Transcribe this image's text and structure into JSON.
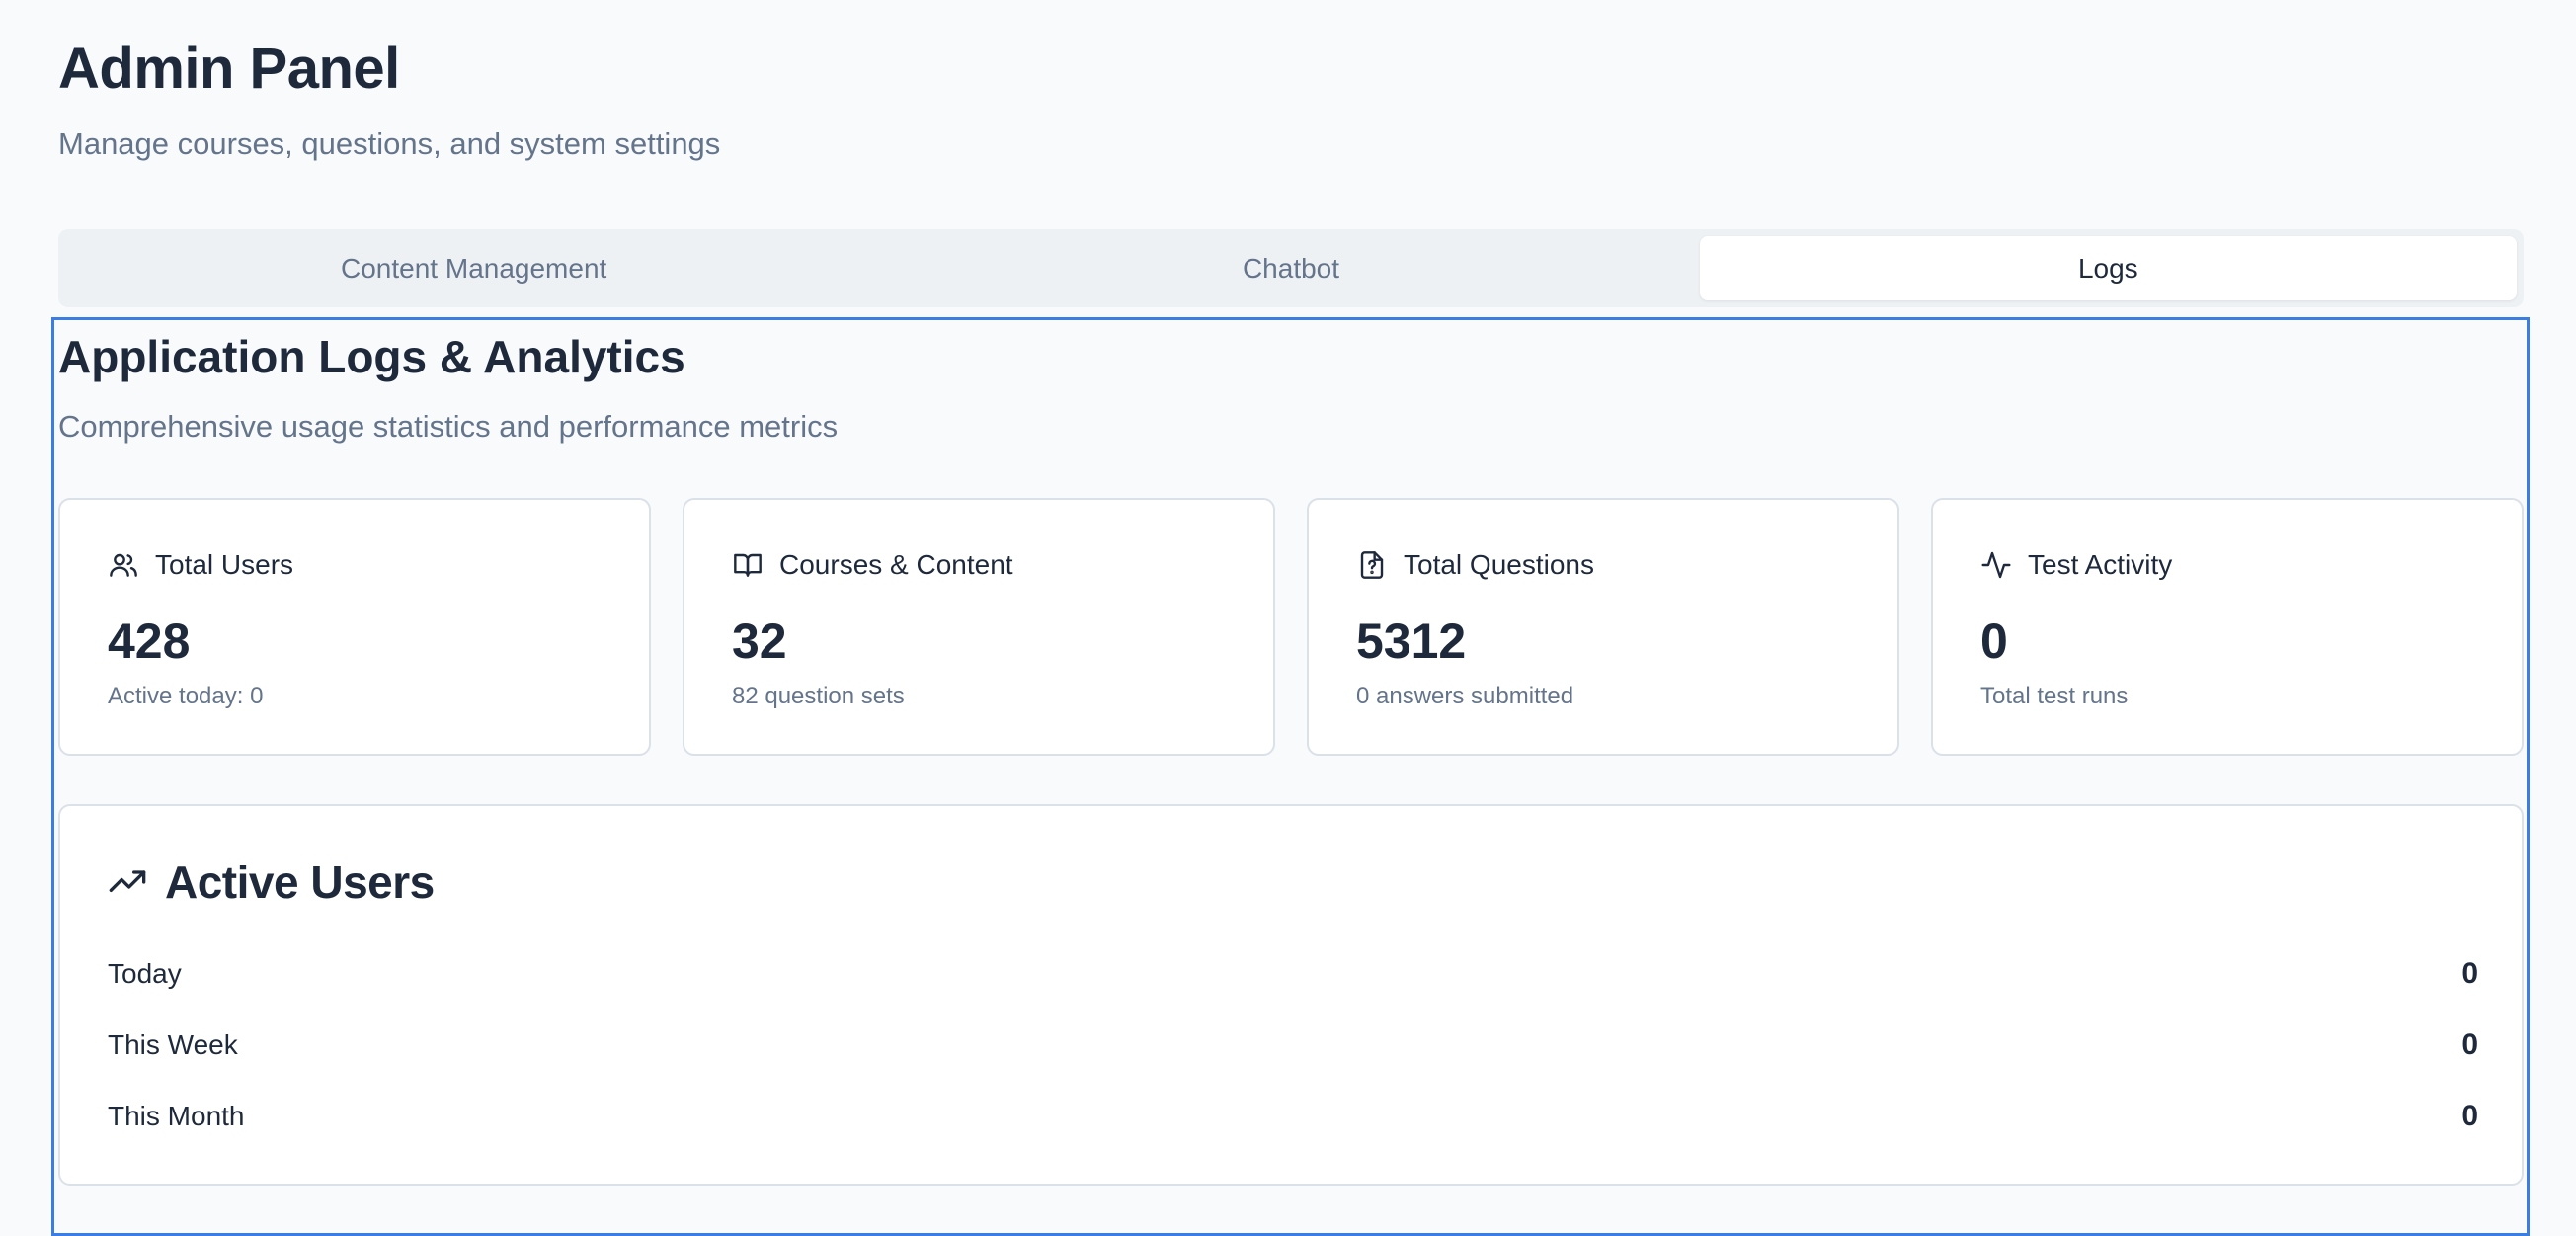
{
  "header": {
    "title": "Admin Panel",
    "subtitle": "Manage courses, questions, and system settings"
  },
  "tabs": [
    {
      "label": "Content Management",
      "active": false
    },
    {
      "label": "Chatbot",
      "active": false
    },
    {
      "label": "Logs",
      "active": true
    }
  ],
  "logs": {
    "title": "Application Logs & Analytics",
    "subtitle": "Comprehensive usage statistics and performance metrics",
    "stats": [
      {
        "icon": "users-icon",
        "label": "Total Users",
        "value": "428",
        "sub": "Active today: 0"
      },
      {
        "icon": "book-open-icon",
        "label": "Courses & Content",
        "value": "32",
        "sub": "82 question sets"
      },
      {
        "icon": "file-question-icon",
        "label": "Total Questions",
        "value": "5312",
        "sub": "0 answers submitted"
      },
      {
        "icon": "activity-icon",
        "label": "Test Activity",
        "value": "0",
        "sub": "Total test runs"
      }
    ],
    "active_users": {
      "icon": "trending-up-icon",
      "title": "Active Users",
      "rows": [
        {
          "label": "Today",
          "value": "0"
        },
        {
          "label": "This Week",
          "value": "0"
        },
        {
          "label": "This Month",
          "value": "0"
        }
      ]
    }
  },
  "colors": {
    "background": "#f8fafc",
    "text": "#1e293b",
    "muted": "#64748b",
    "focus": "#3b7de3"
  }
}
